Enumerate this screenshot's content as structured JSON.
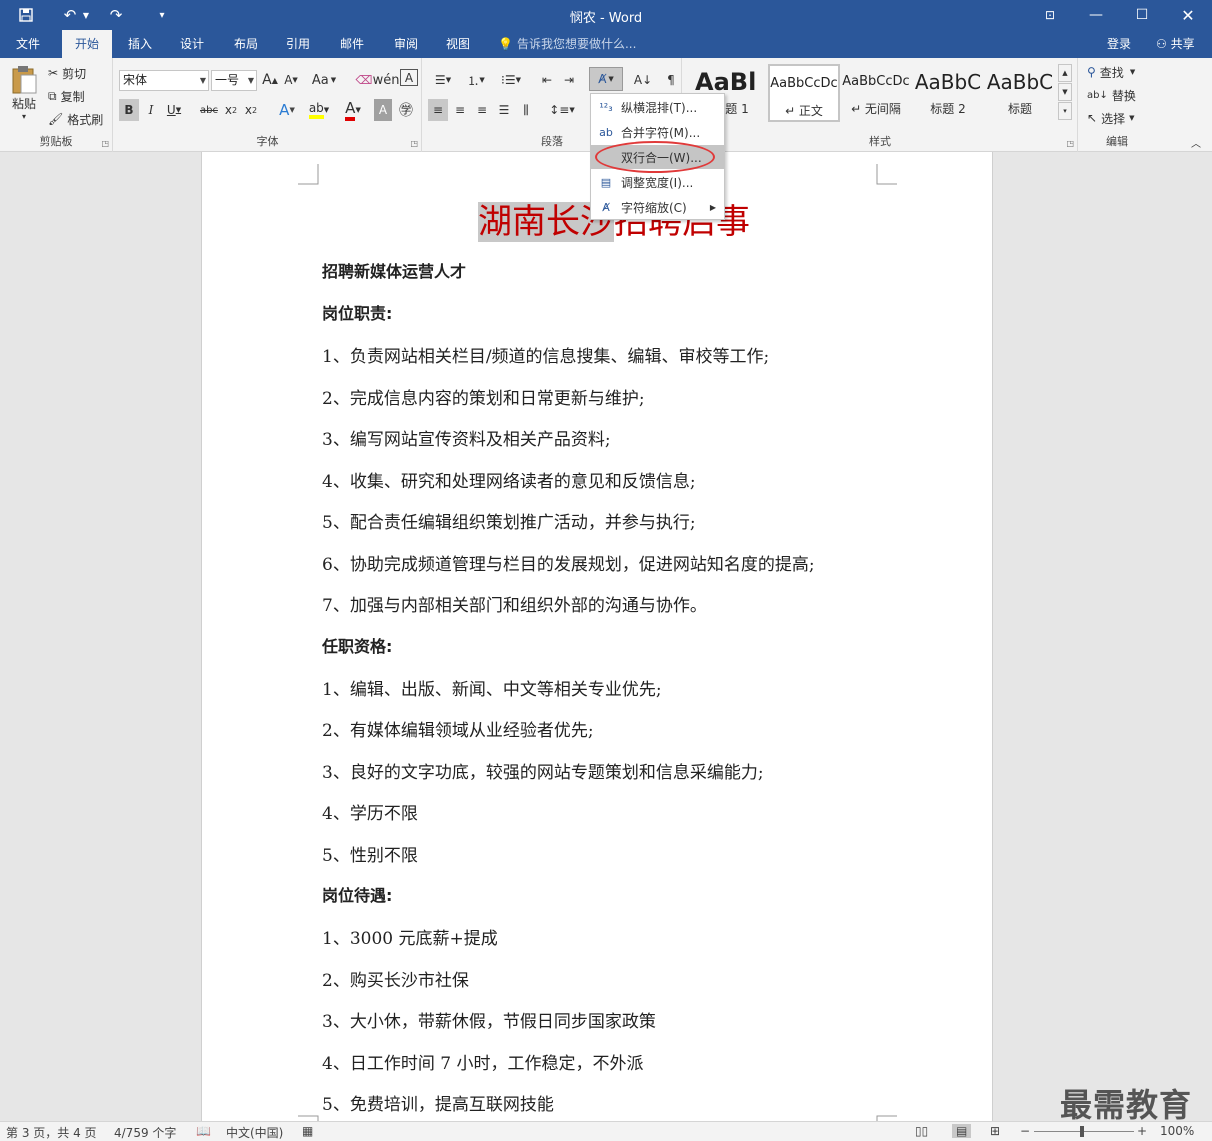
{
  "window": {
    "title": "悯农 - Word",
    "quick_access": [
      "save-icon",
      "undo-icon",
      "redo-icon",
      "customize-icon"
    ]
  },
  "tabs": [
    {
      "label": "文件"
    },
    {
      "label": "开始",
      "active": true
    },
    {
      "label": "插入"
    },
    {
      "label": "设计"
    },
    {
      "label": "布局"
    },
    {
      "label": "引用"
    },
    {
      "label": "邮件"
    },
    {
      "label": "审阅"
    },
    {
      "label": "视图"
    }
  ],
  "tell_me": "告诉我您想要做什么...",
  "account": {
    "login": "登录",
    "share": "共享"
  },
  "clipboard": {
    "paste": "粘贴",
    "cut": "剪切",
    "copy": "复制",
    "format_painter": "格式刷",
    "label": "剪贴板"
  },
  "font": {
    "name": "宋体",
    "size": "一号",
    "label": "字体",
    "case_btn": "Aa"
  },
  "paragraph": {
    "label": "段落"
  },
  "styles": {
    "label": "样式",
    "items": [
      {
        "preview": "AaBl",
        "name": "标题 1"
      },
      {
        "preview": "AaBbCcDc",
        "name": "↵ 正文"
      },
      {
        "preview": "AaBbCcDc",
        "name": "↵ 无间隔"
      },
      {
        "preview": "AaBbC",
        "name": "标题 2"
      },
      {
        "preview": "AaBbC",
        "name": "标题"
      }
    ]
  },
  "editing": {
    "find": "查找",
    "replace": "替换",
    "select": "选择",
    "label": "编辑"
  },
  "menu": {
    "items": [
      {
        "label": "纵横混排(T)..."
      },
      {
        "label": "合并字符(M)..."
      },
      {
        "label": "双行合一(W)..."
      },
      {
        "label": "调整宽度(I)..."
      },
      {
        "label": "字符缩放(C)"
      }
    ]
  },
  "document": {
    "title_selected": "湖南长沙",
    "title_rest": "招聘启事",
    "lines": [
      "招聘新媒体运营人才",
      "岗位职责:",
      "1、负责网站相关栏目/频道的信息搜集、编辑、审校等工作;",
      "2、完成信息内容的策划和日常更新与维护;",
      "3、编写网站宣传资料及相关产品资料;",
      "4、收集、研究和处理网络读者的意见和反馈信息;",
      "5、配合责任编辑组织策划推广活动，并参与执行;",
      "6、协助完成频道管理与栏目的发展规划，促进网站知名度的提高;",
      "7、加强与内部相关部门和组织外部的沟通与协作。",
      "任职资格:",
      "1、编辑、出版、新闻、中文等相关专业优先;",
      "2、有媒体编辑领域从业经验者优先;",
      "3、良好的文字功底，较强的网站专题策划和信息采编能力;",
      "4、学历不限",
      "5、性别不限",
      "岗位待遇:",
      "1、3000 元底薪+提成",
      "2、购买长沙市社保",
      "3、大小休，带薪休假，节假日同步国家政策",
      "4、日工作时间 7 小时，工作稳定，不外派",
      "5、免费培训，提高互联网技能"
    ]
  },
  "status": {
    "page": "第 3 页，共 4 页",
    "words": "4/759 个字",
    "language": "中文(中国)",
    "zoom": "100%"
  },
  "watermark": "最需教育",
  "colors": {
    "brand": "#2b579a",
    "title_red": "#c00000",
    "highlight_ring": "#e03a3a"
  }
}
